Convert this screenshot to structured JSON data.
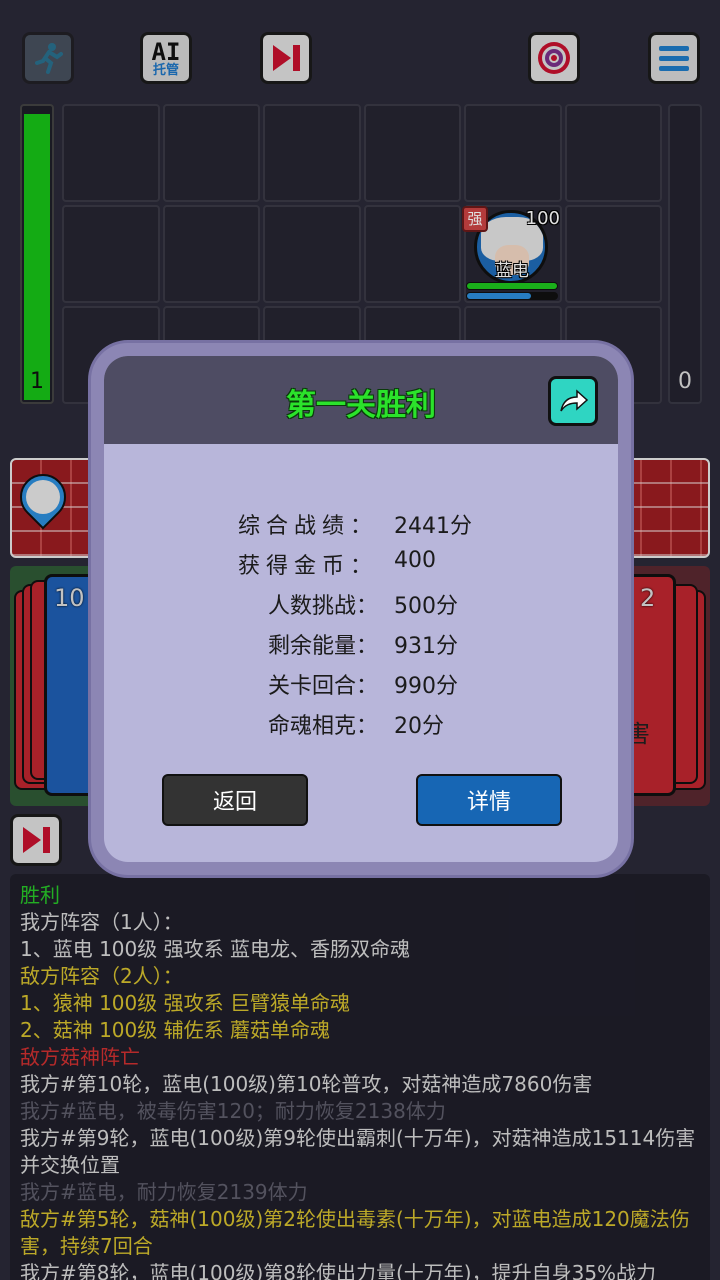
{
  "toolbar": {
    "ai_top": "AI",
    "ai_bottom": "托管"
  },
  "energy": {
    "left_value": "1",
    "right_value": "0"
  },
  "hero": {
    "name": "蓝电",
    "badge": "强",
    "level": "100"
  },
  "cards": {
    "left_count": "10",
    "right_count": "2",
    "right_text": "害"
  },
  "dialog": {
    "title": "第一关胜利",
    "stats": [
      {
        "label": "综合战绩：",
        "value": "2441分"
      },
      {
        "label": "获得金币：",
        "value": "400"
      },
      {
        "label": "人数挑战：",
        "value": "500分"
      },
      {
        "label": "剩余能量：",
        "value": "931分"
      },
      {
        "label": "关卡回合：",
        "value": "990分"
      },
      {
        "label": "命魂相克：",
        "value": "20分"
      }
    ],
    "back_label": "返回",
    "detail_label": "详情"
  },
  "log": [
    {
      "text": "胜利",
      "color": "green"
    },
    {
      "text": "我方阵容（1人）：",
      "color": "white"
    },
    {
      "text": "1、蓝电 100级 强攻系 蓝电龙、香肠双命魂",
      "color": "white"
    },
    {
      "text": "敌方阵容（2人）：",
      "color": "yellow"
    },
    {
      "text": "1、猿神 100级 强攻系 巨臂猿单命魂",
      "color": "yellow"
    },
    {
      "text": "2、菇神 100级 辅佐系 蘑菇单命魂",
      "color": "yellow"
    },
    {
      "text": "敌方菇神阵亡",
      "color": "red"
    },
    {
      "text": "我方#第10轮，蓝电(100级)第10轮普攻，对菇神造成7860伤害",
      "color": "white"
    },
    {
      "text": "我方#蓝电，被毒伤害120；耐力恢复2138体力",
      "color": "gray"
    },
    {
      "text": "我方#第9轮，蓝电(100级)第9轮使出霸刺(十万年)，对菇神造成15114伤害并交换位置",
      "color": "white"
    },
    {
      "text": "我方#蓝电，耐力恢复2139体力",
      "color": "gray"
    },
    {
      "text": "敌方#第5轮，菇神(100级)第2轮使出毒素(十万年)，对蓝电造成120魔法伤害，持续7回合",
      "color": "yellow"
    },
    {
      "text": "我方#第8轮，蓝电(100级)第8轮使出力量(十万年)，提升自身35%战力",
      "color": "white"
    }
  ]
}
